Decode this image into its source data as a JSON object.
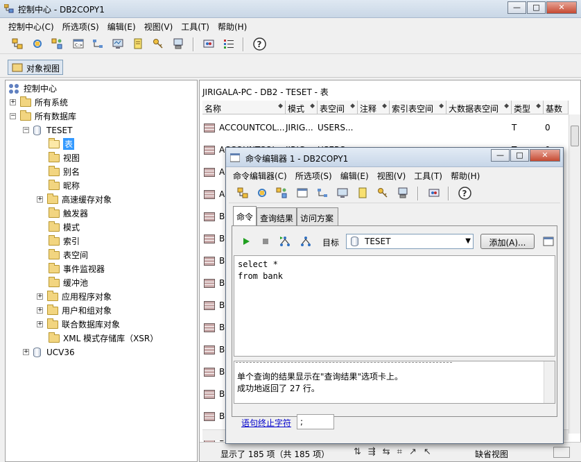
{
  "main": {
    "title": "控制中心 - DB2COPY1",
    "menu": [
      "控制中心(C)",
      "所选项(S)",
      "编辑(E)",
      "视图(V)",
      "工具(T)",
      "帮助(H)"
    ],
    "view_button": "对象视图"
  },
  "tree": {
    "root": "控制中心",
    "all_systems": "所有系统",
    "all_databases": "所有数据库",
    "db_teset": "TESET",
    "db_ucv36": "UCV36",
    "children": [
      "表",
      "视图",
      "别名",
      "昵称",
      "高速缓存对象",
      "触发器",
      "模式",
      "索引",
      "表空间",
      "事件监视器",
      "缓冲池",
      "应用程序对象",
      "用户和组对象",
      "联合数据库对象",
      "XML 模式存储库（XSR）"
    ]
  },
  "content": {
    "path": "JIRIGALA-PC - DB2 - TESET - 表",
    "columns": [
      "名称",
      "模式",
      "表空间",
      "注释",
      "索引表空间",
      "大数据表空间",
      "类型",
      "基数"
    ],
    "rows": [
      {
        "name": "ACCOUNTCOL...",
        "schema": "JIRIG...",
        "tablespace": "USERS...",
        "type": "T",
        "card": "0"
      },
      {
        "name": "ACCOUNTCOL...",
        "schema": "JIRIG...",
        "tablespace": "USERS...",
        "type": "T",
        "card": "0"
      },
      {
        "name": "A"
      },
      {
        "name": "A"
      },
      {
        "name": "B"
      },
      {
        "name": "B"
      },
      {
        "name": "B"
      },
      {
        "name": "B"
      },
      {
        "name": "B"
      },
      {
        "name": "B"
      },
      {
        "name": "B"
      },
      {
        "name": "B"
      },
      {
        "name": "B"
      },
      {
        "name": "B"
      },
      {
        "name": "B"
      }
    ],
    "status": "显示了 185 项（共 185 项）",
    "view_label": "缺省视图"
  },
  "dialog": {
    "title": "命令编辑器 1 - DB2COPY1",
    "menu": [
      "命令编辑器(C)",
      "所选项(S)",
      "编辑(E)",
      "视图(V)",
      "工具(T)",
      "帮助(H)"
    ],
    "tabs": [
      "命令",
      "查询结果",
      "访问方案"
    ],
    "target_label": "目标",
    "target_value": "TESET",
    "add_button": "添加(A)...",
    "sql_lines": [
      "select *",
      "from bank"
    ],
    "messages": [
      "单个查询的结果显示在\"查询结果\"选项卡上。",
      "成功地返回了 27 行。"
    ],
    "terminator_label": "语句终止字符",
    "terminator_value": ";"
  },
  "colors": {
    "selection": "#3399ff",
    "link": "#0000cc"
  }
}
